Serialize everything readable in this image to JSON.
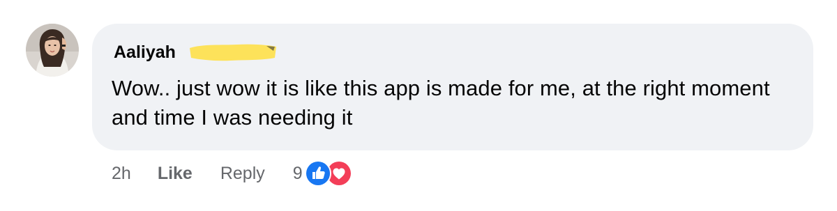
{
  "comment": {
    "author": "Aaliyah",
    "text": "Wow.. just wow it is like this app is made for me, at the right moment and time I was needing it",
    "timestamp": "2h",
    "like_label": "Like",
    "reply_label": "Reply",
    "reaction_count": "9",
    "reactions": [
      "like-icon",
      "love-icon"
    ]
  },
  "colors": {
    "bubble": "#f0f2f5",
    "text": "#050505",
    "meta": "#65676b",
    "like_blue": "#1877f2",
    "love_red": "#f33e58",
    "redaction_yellow": "#fde25a"
  }
}
